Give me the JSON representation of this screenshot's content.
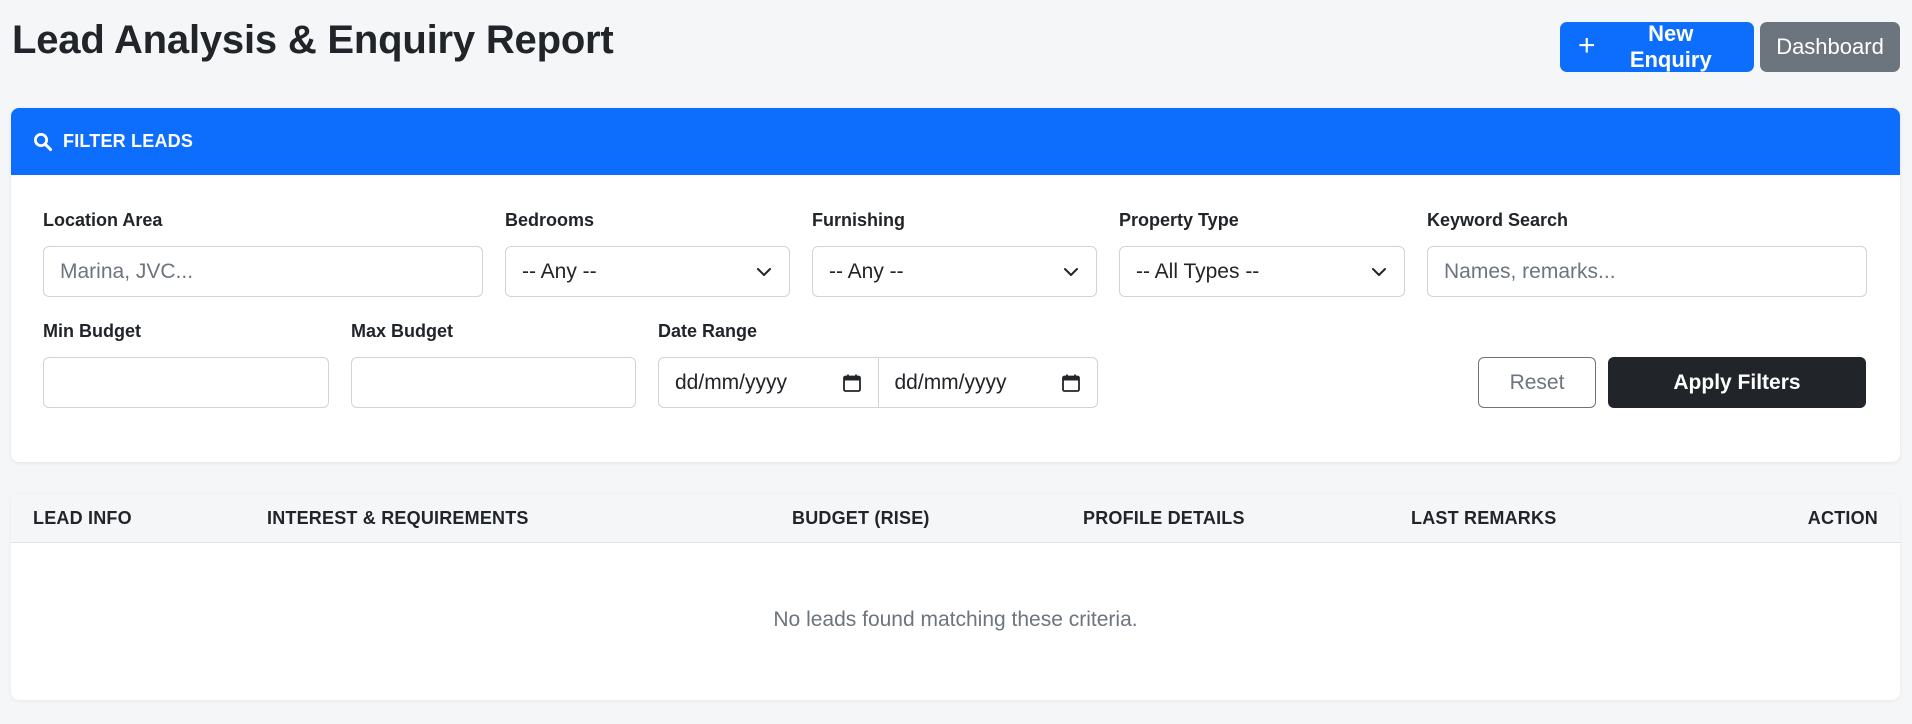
{
  "header": {
    "title": "Lead Analysis & Enquiry Report",
    "new_enquiry_label": "New Enquiry",
    "new_enquiry_icon": "plus-icon",
    "dashboard_label": "Dashboard"
  },
  "filter": {
    "title": "FILTER LEADS",
    "icon": "search-icon",
    "location": {
      "label": "Location Area",
      "placeholder": "Marina, JVC...",
      "value": ""
    },
    "bedrooms": {
      "label": "Bedrooms",
      "selected": "-- Any --"
    },
    "furnishing": {
      "label": "Furnishing",
      "selected": "-- Any --"
    },
    "property_type": {
      "label": "Property Type",
      "selected": "-- All Types --"
    },
    "keyword": {
      "label": "Keyword Search",
      "placeholder": "Names, remarks...",
      "value": ""
    },
    "min_budget": {
      "label": "Min Budget",
      "value": ""
    },
    "max_budget": {
      "label": "Max Budget",
      "value": ""
    },
    "date_range": {
      "label": "Date Range",
      "from": "dd/mm/yyyy",
      "to": "dd/mm/yyyy"
    },
    "reset_label": "Reset",
    "apply_label": "Apply Filters"
  },
  "table": {
    "columns": [
      "LEAD INFO",
      "INTEREST & REQUIREMENTS",
      "BUDGET (RISE)",
      "PROFILE DETAILS",
      "LAST REMARKS",
      "ACTION"
    ],
    "empty_message": "No leads found matching these criteria."
  },
  "colors": {
    "primary": "#0d6efd",
    "secondary": "#6c757d",
    "dark": "#212529",
    "background": "#f5f6f8"
  }
}
